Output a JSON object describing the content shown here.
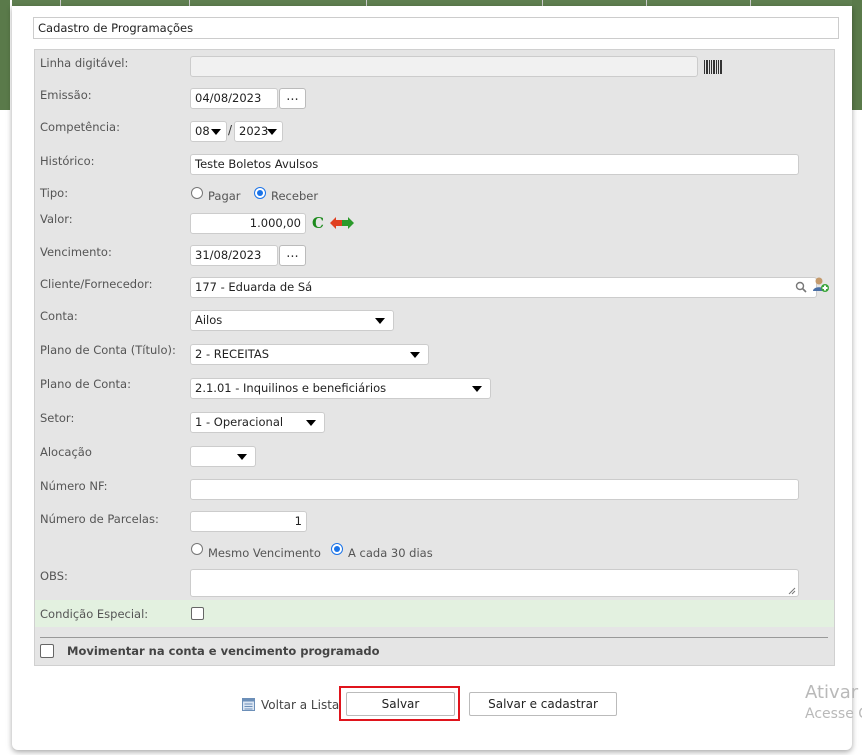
{
  "dialog_title": "Cadastro de Programações",
  "labels": {
    "linha_digitavel": "Linha digitável:",
    "emissao": "Emissão:",
    "competencia": "Competência:",
    "historico": "Histórico:",
    "tipo": "Tipo:",
    "valor": "Valor:",
    "vencimento": "Vencimento:",
    "cliente_fornecedor": "Cliente/Fornecedor:",
    "conta": "Conta:",
    "plano_conta_titulo": "Plano de Conta (Título):",
    "plano_conta": "Plano de Conta:",
    "setor": "Setor:",
    "alocacao": "Alocação",
    "numero_nf": "Número NF:",
    "numero_parcelas": "Número de Parcelas:",
    "obs": "OBS:",
    "condicao_especial": "Condição Especial:",
    "movimentar": "Movimentar na conta e vencimento programado"
  },
  "values": {
    "linha_digitavel": "",
    "emissao": "04/08/2023",
    "competencia_mes": "08",
    "competencia_sep": "/",
    "competencia_ano": "2023",
    "historico": "Teste Boletos Avulsos",
    "valor": "1.000,00",
    "valor_icon_text": "C",
    "vencimento": "31/08/2023",
    "cliente_fornecedor": "177 - Eduarda de Sá",
    "conta": "Ailos",
    "plano_conta_titulo": "2 - RECEITAS",
    "plano_conta": "2.1.01 - Inquilinos e beneficiários",
    "setor": "1 - Operacional",
    "alocacao": "",
    "numero_nf": "",
    "numero_parcelas": "1",
    "obs": "",
    "dots": "..."
  },
  "tipo_options": [
    {
      "label": "Pagar",
      "selected": false
    },
    {
      "label": "Receber",
      "selected": true
    }
  ],
  "parcelas_options": [
    {
      "label": "Mesmo Vencimento",
      "selected": false
    },
    {
      "label": "A cada 30 dias",
      "selected": true
    }
  ],
  "buttons": {
    "voltar": "Voltar a Lista",
    "salvar": "Salvar",
    "salvar_cadastrar": "Salvar e cadastrar"
  },
  "watermark": {
    "line1": "Ativar",
    "line2": "Acesse C"
  },
  "colors": {
    "highlight": "#e0141c",
    "radio_selected": "#1a73e8",
    "condition_row": "#e3f1e0"
  }
}
